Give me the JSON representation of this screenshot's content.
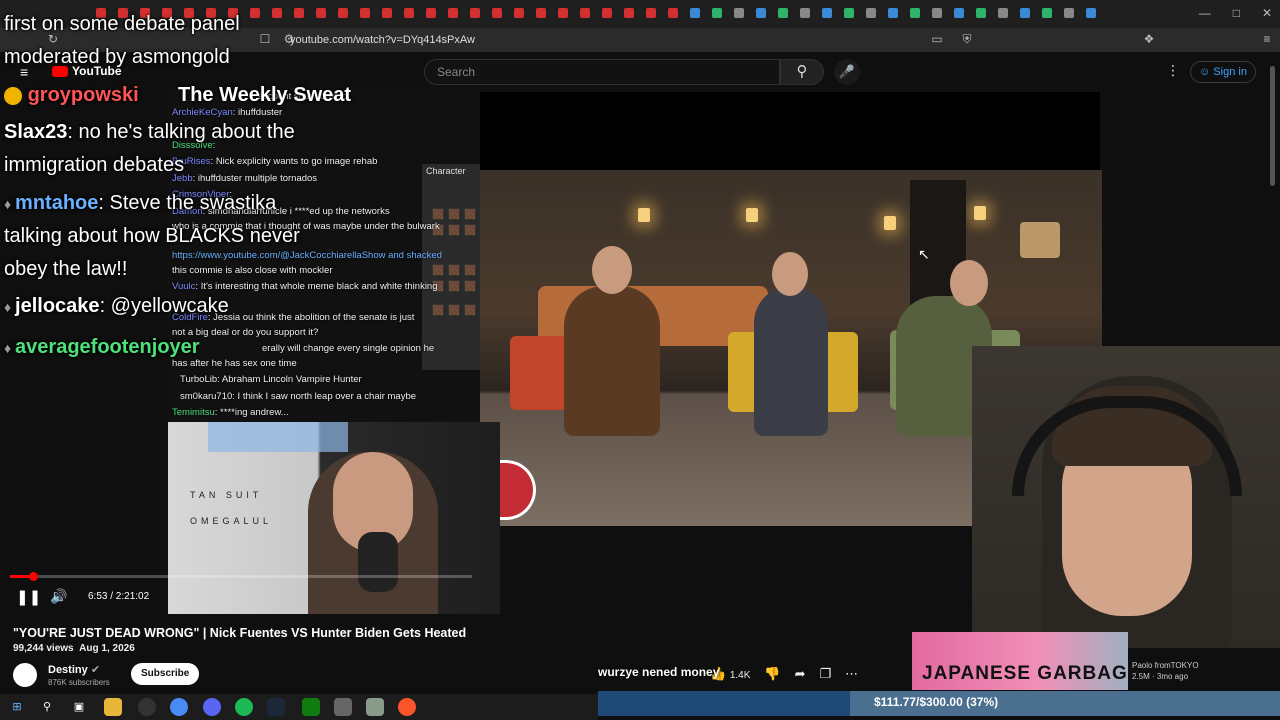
{
  "browser": {
    "url": "youtube.com/watch?v=DYq414sPxAw",
    "window_controls": [
      "—",
      "□",
      "✕"
    ]
  },
  "youtube": {
    "logo": "YouTube",
    "search_placeholder": "Search",
    "sign_in": "Sign in"
  },
  "stream_overlay": {
    "big_chat": [
      {
        "user": "",
        "text": "first on some debate panel"
      },
      {
        "user": "",
        "text": "moderated by asmongold"
      },
      {
        "user": "groypowski",
        "text": "",
        "user_color": "#ff5555"
      },
      {
        "user": "Slax23",
        "text": ": no he's talking about the",
        "user_color": "#ffffff"
      },
      {
        "user": "",
        "text": "immigration debates"
      },
      {
        "user": "mntahoe",
        "text": ": Steve the swastika",
        "user_color": "#6ab0ff"
      },
      {
        "user": "",
        "text": "talking about how BLACKS never"
      },
      {
        "user": "",
        "text": "obey the law!!"
      },
      {
        "user": "jellocake",
        "text": ": @yellowcake",
        "user_color": "#ffffff"
      },
      {
        "user": "averagefootenjoyer",
        "text": "",
        "user_color": "#4ee07a"
      }
    ],
    "weekly_sweat": "The Weekly Sweat",
    "small_chat": [
      {
        "user": "",
        "text": "account shut down lol"
      },
      {
        "user": "ArchieKeCyan",
        "text": ": ihuffduster"
      },
      {
        "user": "Disssolve",
        "text": ":"
      },
      {
        "user": "BruRises",
        "text": ": Nick explicity wants to go image rehab"
      },
      {
        "user": "Jebb",
        "text": ": ihuffduster multiple tornados"
      },
      {
        "user": "CrimsonViper",
        "text": ":"
      },
      {
        "user": "Damon",
        "text": ": simonandiarfunicle i ****ed up the networks"
      },
      {
        "user": "",
        "text": "who is a commie that i thought of was maybe under the bulwark"
      },
      {
        "user": "",
        "text": "https://www.youtube.com/@JackCocchiarellaShow and shacked"
      },
      {
        "user": "",
        "text": "this commie is also close with mockler"
      },
      {
        "user": "Vuulc",
        "text": ": It's interesting that whole meme black and white thinking"
      },
      {
        "user": "ColdFire",
        "text": ": Jessia  ou think the abolition of the senate is just"
      },
      {
        "user": "",
        "text": "not a big deal or do you support it?"
      },
      {
        "user": "",
        "text": "erally will change every single opinion he"
      },
      {
        "user": "",
        "text": "has after he has sex one time"
      },
      {
        "user": "TurboLib",
        "text": ": Abraham Lincoln Vampire Hunter"
      },
      {
        "user": "sm0karu710",
        "text": ": I think I saw north leap over a chair maybe"
      },
      {
        "user": "Temimitsu",
        "text": ": ****ing andrew..."
      }
    ],
    "character_panel_label": "Character",
    "cam1_text_line1": "TAN SUIT",
    "cam1_text_line2": "OMEGALUL",
    "donation_text": "wurzye nened money",
    "goal_text": "$111.77/$300.00 (37%)",
    "goal_fraction": 0.37
  },
  "player": {
    "time": "6:53 / 2:21:02",
    "progress_fraction": 0.049
  },
  "video": {
    "title": "\"YOU'RE JUST DEAD WRONG\" | Nick Fuentes VS Hunter Biden Gets Heated",
    "views": "99,244 views",
    "date": "Aug 1, 2026",
    "channel": "Destiny",
    "subscribers": "876K subscribers",
    "subscribe_label": "Subscribe",
    "likes": "1.4K"
  },
  "suggestion": {
    "thumb_text": "JAPANESE GARBAGEMAN",
    "channel": "Paolo fromTOKYO",
    "meta": "2.5M · 3mo ago"
  }
}
